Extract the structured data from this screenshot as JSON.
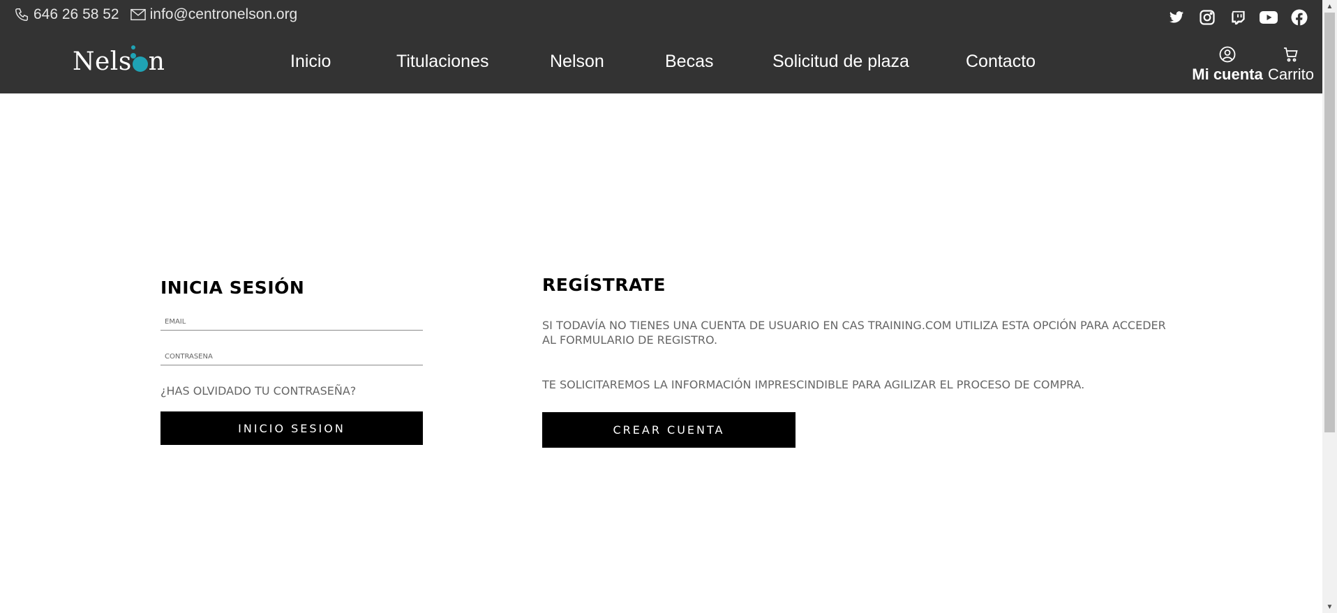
{
  "header": {
    "phone": "646 26 58 52",
    "email": "info@centronelson.org",
    "logo": {
      "prefix": "Nels",
      "suffix": "n"
    },
    "nav": [
      "Inicio",
      "Titulaciones",
      "Nelson",
      "Becas",
      "Solicitud de plaza",
      "Contacto"
    ],
    "account_label": "Mi cuenta",
    "cart_label": "Carrito",
    "social_icons": [
      "twitter-icon",
      "instagram-icon",
      "twitch-icon",
      "youtube-icon",
      "facebook-icon"
    ]
  },
  "login": {
    "title": "INICIA SESIÓN",
    "email_placeholder": "EMAIL",
    "password_placeholder": "CONTRASEÑA",
    "forgot": "¿HAS OLVIDADO TU CONTRASEÑA?",
    "submit": "INICIO SESION"
  },
  "register": {
    "title": "REGÍSTRATE",
    "text1": "SI TODAVÍA NO TIENES UNA CUENTA DE USUARIO EN CAS TRAINING.COM UTILIZA ESTA OPCIÓN PARA ACCEDER AL FORMULARIO DE REGISTRO.",
    "text2": "TE SOLICITAREMOS LA INFORMACIÓN IMPRESCINDIBLE PARA AGILIZAR EL PROCESO DE COMPRA.",
    "button": "CREAR CUENTA"
  },
  "colors": {
    "header_bg": "#333333",
    "logo_accent": "#1fa3b5",
    "button_bg": "#000000"
  }
}
